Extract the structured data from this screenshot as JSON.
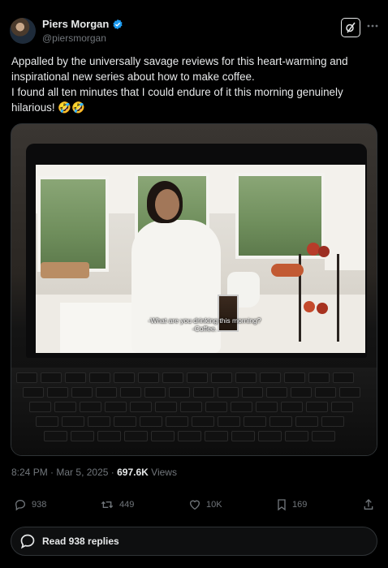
{
  "author": {
    "name": "Piers Morgan",
    "handle": "@piersmorgan",
    "verified": true,
    "verified_color": "#1d9bf0"
  },
  "tweet": {
    "line1": "Appalled by the universally savage reviews for this heart-warming and inspirational new series about how to make coffee.",
    "line2": "I found all ten minutes that I could endure of it this morning genuinely hilarious! 🤣🤣"
  },
  "media": {
    "subtitle_line1": "-What are you drinking this morning?",
    "subtitle_line2": "-Coffee."
  },
  "meta": {
    "time": "8:24 PM",
    "separator": "·",
    "date": "Mar 5, 2025",
    "views_count": "697.6K",
    "views_label": "Views"
  },
  "actions": {
    "replies": "938",
    "reposts": "449",
    "likes": "10K",
    "bookmarks": "169"
  },
  "read_replies": {
    "label": "Read 938 replies"
  },
  "icons": {
    "grok": "grok-icon",
    "more": "more-icon",
    "reply": "reply-icon",
    "repost": "repost-icon",
    "like": "heart-icon",
    "bookmark": "bookmark-icon",
    "share": "share-icon",
    "replies_bubble": "speech-bubble-icon"
  }
}
